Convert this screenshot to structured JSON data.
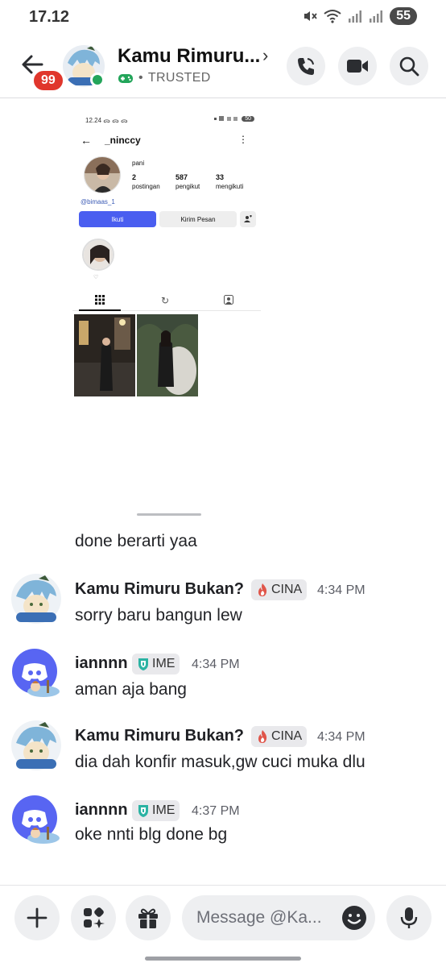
{
  "status_bar": {
    "time": "17.12",
    "battery": "55"
  },
  "header": {
    "unread_badge": "99",
    "name": "Kamu Rimuru...",
    "chevron": "›",
    "subtitle": "TRUSTED",
    "separator": "•"
  },
  "embedded": {
    "time": "12.24",
    "status_icons": "ᯅ ᯅ ᯅ",
    "battery": "50",
    "username": "_ninccy",
    "display_name": "pani",
    "stats": [
      {
        "value": "2",
        "label": "postingan"
      },
      {
        "value": "587",
        "label": "pengikut"
      },
      {
        "value": "33",
        "label": "mengikuti"
      }
    ],
    "tagged_user": "@bimaas_1",
    "follow_label": "Ikuti",
    "message_label": "Kirim Pesan",
    "highlight_label": "♡"
  },
  "messages": [
    {
      "text": "done berarti yaa"
    },
    {
      "author": "Kamu Rimuru Bukan?",
      "tag": "CINA",
      "time": "4:34 PM",
      "text": "sorry baru bangun lew"
    },
    {
      "author": "iannnn",
      "tag": "IME",
      "time": "4:34 PM",
      "text": "aman aja bang"
    },
    {
      "author": "Kamu Rimuru Bukan?",
      "tag": "CINA",
      "time": "4:34 PM",
      "text": "dia dah konfir masuk,gw cuci muka dlu"
    },
    {
      "author": "iannnn",
      "tag": "IME",
      "time": "4:37 PM",
      "text": "oke nnti blg done bg"
    }
  ],
  "composer": {
    "placeholder": "Message @Ka..."
  },
  "colors": {
    "accent": "#5865f2",
    "online": "#23a55a",
    "badge": "#e0362c",
    "ig_blue": "#4a5ef0"
  }
}
